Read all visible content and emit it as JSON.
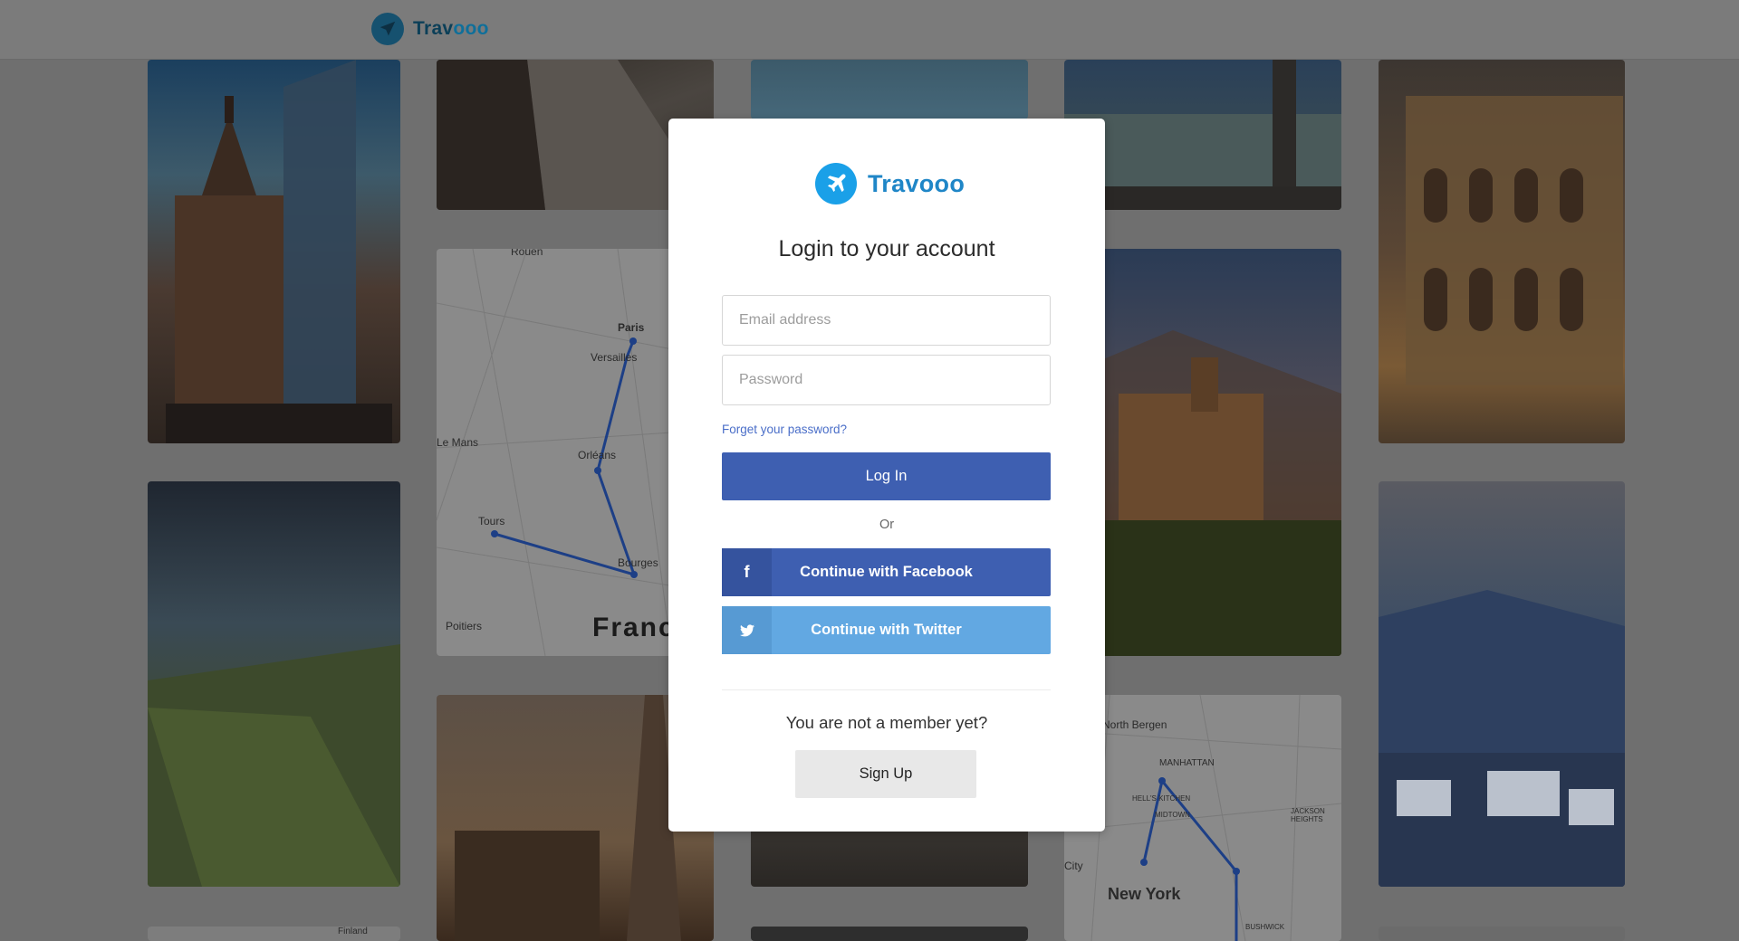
{
  "header": {
    "brand_prefix": "Trav",
    "brand_suffix": "ooo"
  },
  "background": {
    "map_france": {
      "cities": [
        "Rouen",
        "Paris",
        "Versailles",
        "Le Mans",
        "Orléans",
        "Tours",
        "Bourges",
        "Poitiers"
      ],
      "country_label": "Franc"
    },
    "map_newyork": {
      "areas": [
        "North Bergen",
        "MANHATTAN",
        "HELL'S KITCHEN",
        "MIDTOWN",
        "JACKSON HEIGHTS",
        "City",
        "BUSHWICK"
      ],
      "city_label": "New York"
    },
    "bottom_map_label": "Finland"
  },
  "login": {
    "brand": "Travooo",
    "title": "Login to your account",
    "email_placeholder": "Email address",
    "password_placeholder": "Password",
    "forgot_link": "Forget your password?",
    "login_button": "Log In",
    "or_text": "Or",
    "facebook_button": "Continue with Facebook",
    "facebook_icon": "facebook-icon",
    "twitter_button": "Continue with Twitter",
    "twitter_icon": "twitter-icon",
    "member_prompt": "You are not a member yet?",
    "signup_button": "Sign Up"
  },
  "colors": {
    "primary": "#3e5fb1",
    "twitter": "#62a8e2",
    "brand_blue": "#1aa0e8",
    "link": "#4a6ec8"
  }
}
